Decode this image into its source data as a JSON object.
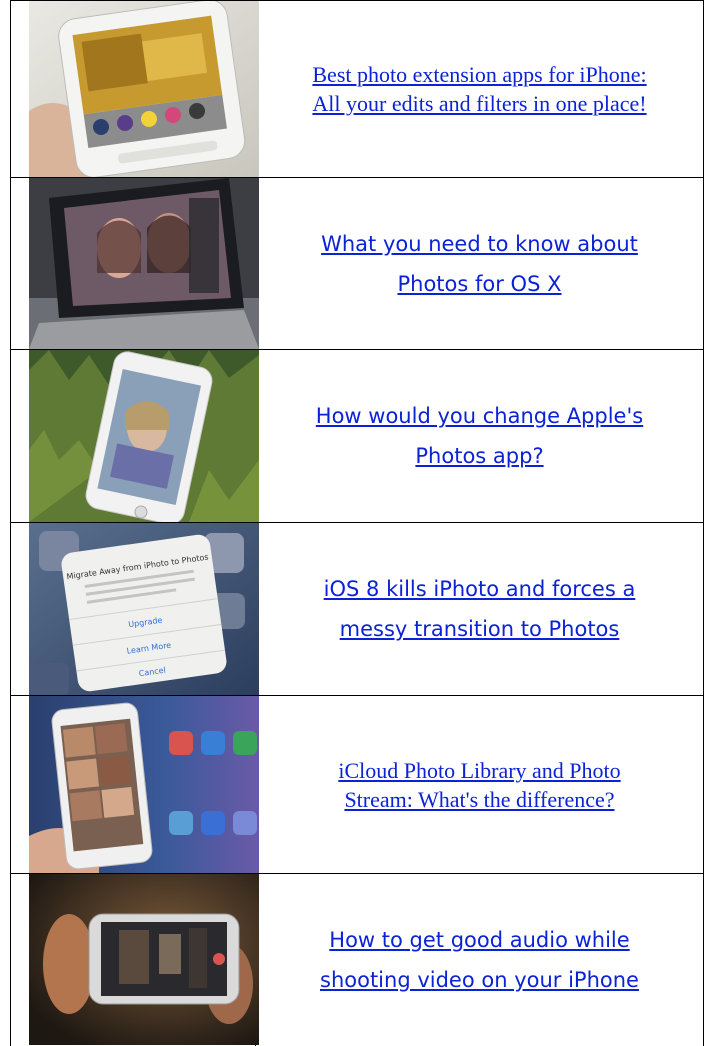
{
  "articles": [
    {
      "title_line1": "Best photo extension apps for iPhone:",
      "title_line2": "All your edits and filters in one place!",
      "style": "serif",
      "thumbnail": "iphone-photo-extensions-thumbnail"
    },
    {
      "title_line1": "What you need to know about",
      "title_line2": "Photos for OS X",
      "style": "sans",
      "thumbnail": "macbook-photos-thumbnail"
    },
    {
      "title_line1": "How would you change Apple's",
      "title_line2": "Photos app?",
      "style": "sans",
      "thumbnail": "iphone-on-grass-thumbnail"
    },
    {
      "title_line1": "iOS 8 kills iPhoto and forces a",
      "title_line2": "messy transition to Photos",
      "style": "sans",
      "thumbnail": "ipad-migrate-dialog-thumbnail"
    },
    {
      "title_line1": "iCloud Photo Library and Photo",
      "title_line2": "Stream: What's the difference?",
      "style": "serif",
      "thumbnail": "iphone-icloud-library-thumbnail"
    },
    {
      "title_line1": "How to get good audio while",
      "title_line2": "shooting video on your iPhone",
      "style": "sans",
      "thumbnail": "iphone-video-recording-thumbnail"
    }
  ],
  "dialog": {
    "title": "Migrate Away from iPhoto to Photos",
    "button_upgrade": "Upgrade",
    "button_learn": "Learn More",
    "button_cancel": "Cancel"
  }
}
